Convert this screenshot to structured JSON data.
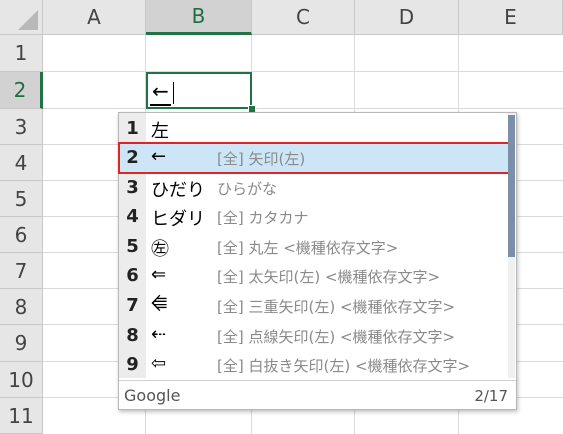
{
  "sheet": {
    "columns": [
      "A",
      "B",
      "C",
      "D",
      "E"
    ],
    "rows": [
      "1",
      "2",
      "3",
      "4",
      "5",
      "6",
      "7",
      "8",
      "9",
      "10",
      "11"
    ],
    "active_cell": {
      "column": "B",
      "row": "2",
      "value": "←"
    }
  },
  "ime": {
    "candidates": [
      {
        "num": "1",
        "word": "左",
        "desc": ""
      },
      {
        "num": "2",
        "word": "←",
        "desc": "[全] 矢印(左)"
      },
      {
        "num": "3",
        "word": "ひだり",
        "desc": "ひらがな"
      },
      {
        "num": "4",
        "word": "ヒダリ",
        "desc": "[全] カタカナ"
      },
      {
        "num": "5",
        "word": "㊧",
        "desc": "[全] 丸左 <機種依存文字>"
      },
      {
        "num": "6",
        "word": "⇐",
        "desc": "[全] 太矢印(左) <機種依存文字>"
      },
      {
        "num": "7",
        "word": "⭅",
        "desc": "[全] 三重矢印(左) <機種依存文字>"
      },
      {
        "num": "8",
        "word": "⇠",
        "desc": "[全] 点線矢印(左) <機種依存文字>"
      },
      {
        "num": "9",
        "word": "⇦",
        "desc": "[全] 白抜き矢印(左) <機種依存文字>"
      }
    ],
    "selected_index": 1,
    "brand": "Google",
    "page_indicator": "2/17"
  },
  "colors": {
    "accent": "#217346",
    "selection_bg": "#cde6f7",
    "selection_border": "#e02424"
  }
}
